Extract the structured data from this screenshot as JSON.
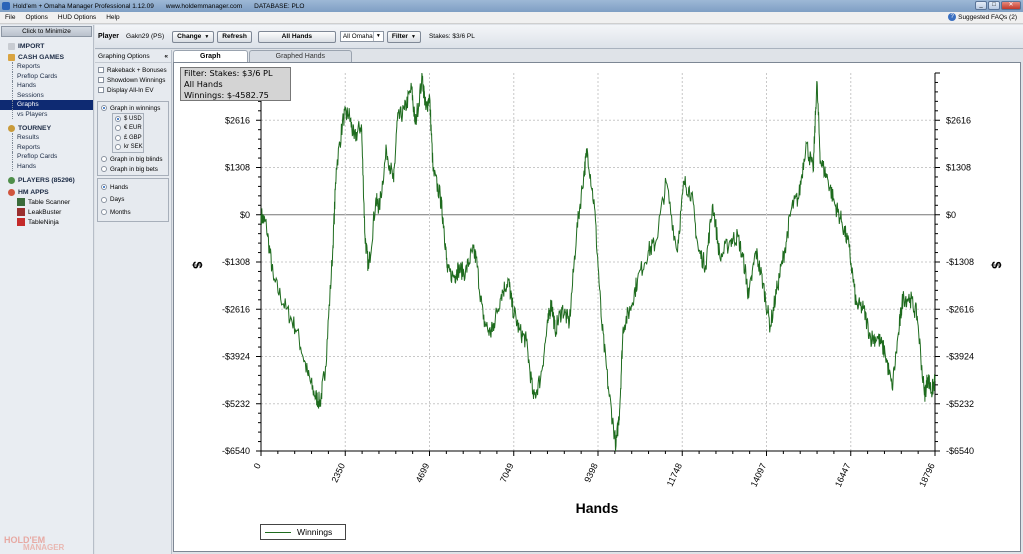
{
  "titlebar": {
    "app_title": "Hold'em + Omaha Manager Professional 1.12.09",
    "website": "www.holdemmanager.com",
    "database": "DATABASE: PLO"
  },
  "menu": {
    "items": [
      "File",
      "Options",
      "HUD Options",
      "Help"
    ],
    "faq_label": "Suggested FAQs (2)"
  },
  "sidebar": {
    "minimize_label": "Click to Minimize",
    "import_label": "IMPORT",
    "cash_games": {
      "label": "CASH GAMES",
      "items": [
        "Reports",
        "Preflop Cards",
        "Hands",
        "Sessions",
        "Graphs",
        "vs Players"
      ],
      "active": "Graphs"
    },
    "tourney": {
      "label": "TOURNEY",
      "items": [
        "Results",
        "Reports",
        "Preflop Cards",
        "Hands"
      ]
    },
    "players_label": "PLAYERS (85296)",
    "hm_apps": {
      "label": "HM APPS",
      "items": [
        "Table Scanner",
        "LeakBuster",
        "TableNinja"
      ]
    },
    "brand_line1": "HOLD'EM",
    "brand_line2": "MANAGER"
  },
  "toolbar": {
    "player_label": "Player",
    "player_value": "Gakn29 (PS)",
    "change_label": "Change",
    "refresh_label": "Refresh",
    "all_hands_label": "All Hands",
    "game_select_value": "All Omaha",
    "filter_label": "Filter",
    "stakes_text": "Stakes: $3/6 PL"
  },
  "graph_options": {
    "header": "Graphing Options",
    "collapse_icon": "double-chevron-left-icon",
    "checkboxes": [
      "Rakeback + Bonuses",
      "Showdown Winnings",
      "Display All-In EV"
    ],
    "graph_in_winnings": "Graph in winnings",
    "currencies": [
      "$ USD",
      "€ EUR",
      "£ GBP",
      "kr SEK"
    ],
    "selected_currency": "$ USD",
    "graph_in_big_blinds": "Graph in big blinds",
    "graph_in_big_bets": "Graph in big bets",
    "x_modes": [
      "Hands",
      "Days",
      "Months"
    ],
    "selected_x_mode": "Hands"
  },
  "tabs": [
    "Graph",
    "Graphed Hands"
  ],
  "active_tab": "Graph",
  "filter_box": {
    "line1": "Filter: Stakes: $3/6 PL",
    "line2": "All Hands",
    "line3": "Winnings: $-4582.75"
  },
  "colors": {
    "series": "#1e6b1e",
    "nav_active": "#0e2a72",
    "filter_box": "#d4d4d4"
  },
  "chart_data": {
    "type": "line",
    "xlabel": "Hands",
    "ylabel": "$",
    "xlim": [
      0,
      18796
    ],
    "ylim": [
      -6540,
      3924
    ],
    "x_ticks": [
      0,
      2350,
      4699,
      7049,
      9398,
      11748,
      14097,
      16447,
      18796
    ],
    "y_ticks": [
      2616,
      1308,
      0,
      -1308,
      -2616,
      -3924,
      -5232,
      -6540
    ],
    "y_tick_labels": [
      "$2616",
      "$1308",
      "$0",
      "-$1308",
      "-$2616",
      "-$3924",
      "-$5232",
      "-$6540"
    ],
    "legend_position": "bottom-left",
    "grid": true,
    "series": [
      {
        "name": "Winnings",
        "x": [
          0,
          150,
          350,
          700,
          1000,
          1300,
          1500,
          1650,
          1800,
          2000,
          2100,
          2300,
          2450,
          2600,
          2800,
          2900,
          3000,
          3200,
          3300,
          3500,
          3700,
          3800,
          4000,
          4200,
          4300,
          4500,
          4600,
          4700,
          4800,
          5000,
          5100,
          5200,
          5400,
          5500,
          5700,
          5900,
          6000,
          6200,
          6400,
          6500,
          6700,
          6900,
          7000,
          7200,
          7400,
          7600,
          7800,
          8000,
          8100,
          8200,
          8400,
          8600,
          8800,
          9000,
          9100,
          9300,
          9500,
          9700,
          9900,
          10000,
          10100,
          10300,
          10500,
          10800,
          11000,
          11300,
          11600,
          11800,
          12000,
          12200,
          12400,
          12600,
          12800,
          13100,
          13300,
          13500,
          13600,
          13800,
          14000,
          14200,
          14400,
          14600,
          14800,
          15000,
          15200,
          15400,
          15500,
          15600,
          15800,
          16000,
          16200,
          16400,
          16600,
          16800,
          17000,
          17200,
          17400,
          17600,
          17800,
          17900,
          18100,
          18300,
          18500,
          18600,
          18700,
          18796
        ],
        "y": [
          0,
          -300,
          -1800,
          -2600,
          -3200,
          -4400,
          -5000,
          -5200,
          -4200,
          -1000,
          1300,
          2700,
          2800,
          2100,
          2500,
          -600,
          -1500,
          400,
          200,
          1800,
          900,
          2600,
          2900,
          3500,
          2500,
          3800,
          2900,
          3300,
          1200,
          500,
          -300,
          -1600,
          -1700,
          -1500,
          -1600,
          -1000,
          -1200,
          -2900,
          -3300,
          -3000,
          -2200,
          -1800,
          -2500,
          -3200,
          -3500,
          -5100,
          -4500,
          -3000,
          -2400,
          -3200,
          -2600,
          -3000,
          -500,
          1100,
          1800,
          200,
          -3000,
          -4900,
          -6400,
          -5400,
          -3100,
          -2600,
          -1800,
          -1000,
          -800,
          900,
          -1000,
          900,
          600,
          -1000,
          -1400,
          300,
          -1200,
          -700,
          -600,
          -1500,
          -2300,
          -1000,
          -1900,
          -3100,
          -2000,
          -1000,
          200,
          500,
          2000,
          1200,
          3700,
          1500,
          1000,
          300,
          -200,
          -900,
          -2500,
          -2600,
          -3400,
          -3400,
          -3800,
          -4800,
          -3100,
          -2300,
          -2300,
          -2800,
          -5000,
          -4500,
          -4900,
          -4600
        ]
      }
    ]
  }
}
